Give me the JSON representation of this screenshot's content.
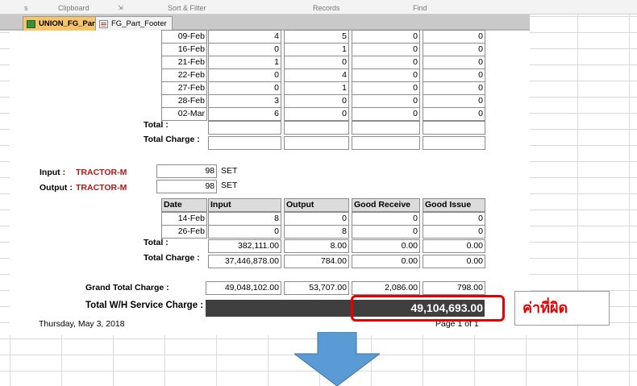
{
  "ribbon": {
    "groups": [
      "s",
      "Clipboard",
      "Sort & Filter",
      "Records",
      "Find"
    ]
  },
  "tabs": [
    {
      "label": "UNION_FG_Part",
      "icon": "table-icon",
      "active": true
    },
    {
      "label": "FG_Part_Footer",
      "icon": "report-icon",
      "active": false
    }
  ],
  "section1": {
    "rows": [
      [
        "09-Feb",
        "4",
        "5",
        "0",
        "0"
      ],
      [
        "16-Feb",
        "0",
        "1",
        "0",
        "0"
      ],
      [
        "21-Feb",
        "1",
        "0",
        "0",
        "0"
      ],
      [
        "22-Feb",
        "0",
        "4",
        "0",
        "0"
      ],
      [
        "27-Feb",
        "0",
        "1",
        "0",
        "0"
      ],
      [
        "28-Feb",
        "3",
        "0",
        "0",
        "0"
      ],
      [
        "02-Mar",
        "6",
        "0",
        "0",
        "0"
      ]
    ],
    "total_label": "Total :",
    "total_charge_label": "Total Charge :"
  },
  "section2": {
    "input_label": "Input :",
    "output_label": "Output :",
    "input_model": "TRACTOR-M",
    "output_model": "TRACTOR-M",
    "input_qty": "98",
    "output_qty": "98",
    "unit": "SET",
    "headers": [
      "Date",
      "Input",
      "Output",
      "Good Receive",
      "Good Issue"
    ],
    "rows": [
      [
        "14-Feb",
        "8",
        "0",
        "0",
        "0"
      ],
      [
        "26-Feb",
        "0",
        "8",
        "0",
        "0"
      ]
    ],
    "total_label": "Total :",
    "total": [
      "382,111.00",
      "8.00",
      "0.00",
      "0.00"
    ],
    "total_charge_label": "Total Charge :",
    "total_charge": [
      "37,446,878.00",
      "784.00",
      "0.00",
      "0.00"
    ]
  },
  "grand": {
    "label": "Grand Total Charge :",
    "values": [
      "49,048,102.00",
      "53,707.00",
      "2,086.00",
      "798.00"
    ],
    "service_label": "Total W/H Service Charge :",
    "service_value": "49,104,693.00"
  },
  "footer": {
    "date": "Thursday, May 3, 2018",
    "page": "Page 1 of 1"
  },
  "annotation": {
    "note": "ค่าที่ผิด",
    "color": "#e60000"
  }
}
